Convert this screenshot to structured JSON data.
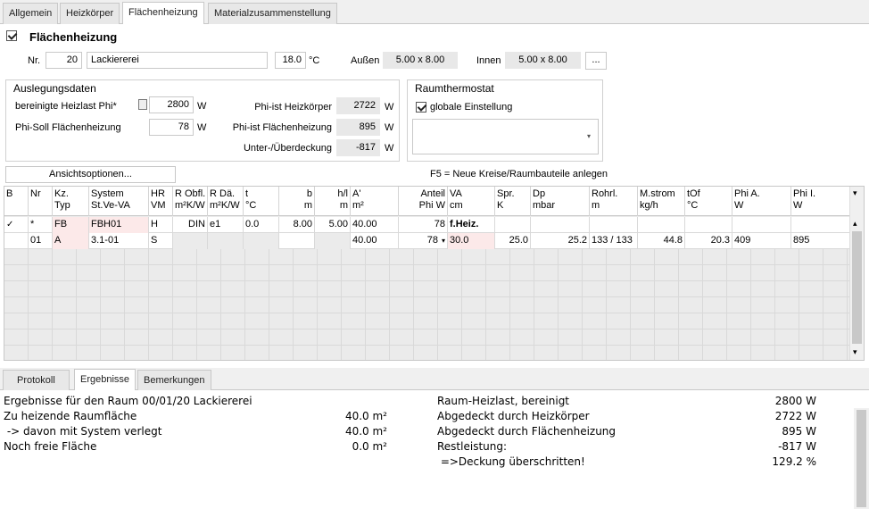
{
  "top_tabs": [
    "Allgemein",
    "Heizkörper",
    "Flächenheizung",
    "Materialzusammenstellung"
  ],
  "section_title": "Flächenheizung",
  "room": {
    "nr_label": "Nr.",
    "nr_value": "20",
    "name_value": "Lackiererei",
    "temp_value": "18.0",
    "temp_unit": "°C",
    "aussen_label": "Außen",
    "aussen_value": "5.00 x 8.00",
    "innen_label": "Innen",
    "innen_value": "5.00 x 8.00",
    "more_button": "..."
  },
  "auslegung": {
    "title": "Auslegungsdaten",
    "heizlast_label": "bereinigte Heizlast Phi*",
    "heizlast_value": "2800",
    "heizlast_unit": "W",
    "phisoll_label": "Phi-Soll Flächenheizung",
    "phisoll_value": "78",
    "phisoll_unit": "W",
    "phiist_hk_label": "Phi-ist Heizkörper",
    "phiist_hk_value": "2722",
    "phiist_hk_unit": "W",
    "phiist_fh_label": "Phi-ist Flächenheizung",
    "phiist_fh_value": "895",
    "phiist_fh_unit": "W",
    "unter_label": "Unter-/Überdeckung",
    "unter_value": "-817",
    "unter_unit": "W"
  },
  "raumthermostat": {
    "title": "Raumthermostat",
    "global_label": "globale Einstellung",
    "global_checked": true
  },
  "ansicht_button": "Ansichtsoptionen...",
  "f5_hint": "F5 = Neue Kreise/Raumbauteile anlegen",
  "grid": {
    "headers": [
      [
        "B",
        ""
      ],
      [
        "Nr",
        ""
      ],
      [
        "Kz.",
        "Typ"
      ],
      [
        "System",
        "St.Ve-VA"
      ],
      [
        "HR",
        "VM"
      ],
      [
        "R Obfl.",
        "m²K/W"
      ],
      [
        "R Dä.",
        "m²K/W"
      ],
      [
        "t",
        "°C"
      ],
      [
        "b",
        "m"
      ],
      [
        "h/l",
        "m"
      ],
      [
        "A'",
        "m²"
      ],
      [
        "Anteil",
        "Phi W"
      ],
      [
        "VA",
        "cm"
      ],
      [
        "Spr.",
        "K"
      ],
      [
        "Dp",
        "mbar"
      ],
      [
        "Rohrl.",
        "m"
      ],
      [
        "M.strom",
        "kg/h"
      ],
      [
        "tOf",
        "°C"
      ],
      [
        "Phi A.",
        "W"
      ],
      [
        "Phi I.",
        "W"
      ]
    ],
    "row1": [
      "✓",
      "*",
      "FB",
      "FBH01",
      "H",
      "DIN",
      "e1",
      "0.0",
      "8.00",
      "5.00",
      "40.00",
      "78",
      "f.Heiz.",
      "",
      "",
      "",
      "",
      "",
      "",
      ""
    ],
    "row2": [
      "",
      "01",
      "A",
      "3.1-01",
      "S",
      "",
      "",
      "",
      "",
      "",
      "40.00",
      "78",
      "30.0",
      "25.0",
      "25.2",
      "133 / 133",
      "44.8",
      "20.3",
      "409",
      "895"
    ]
  },
  "bottom_tabs": [
    "Protokoll",
    "Ergebnisse",
    "Bemerkungen"
  ],
  "results": {
    "left": [
      {
        "label": "Ergebnisse für den Raum 00/01/20 Lackiererei",
        "value": ""
      },
      {
        "label": "Zu heizende Raumfläche",
        "value": "40.0 m²"
      },
      {
        "label": " -> davon mit System verlegt",
        "value": "40.0 m²"
      },
      {
        "label": "Noch freie Fläche",
        "value": "0.0 m²"
      }
    ],
    "right": [
      {
        "label": "Raum-Heizlast, bereinigt",
        "value": "2800 W"
      },
      {
        "label": "Abgedeckt durch Heizkörper",
        "value": "2722 W"
      },
      {
        "label": "Abgedeckt durch Flächenheizung",
        "value": "895 W"
      },
      {
        "label": "Restleistung:",
        "value": "-817 W"
      },
      {
        "label": " =>Deckung überschritten!",
        "value": "129.2 %"
      }
    ]
  }
}
